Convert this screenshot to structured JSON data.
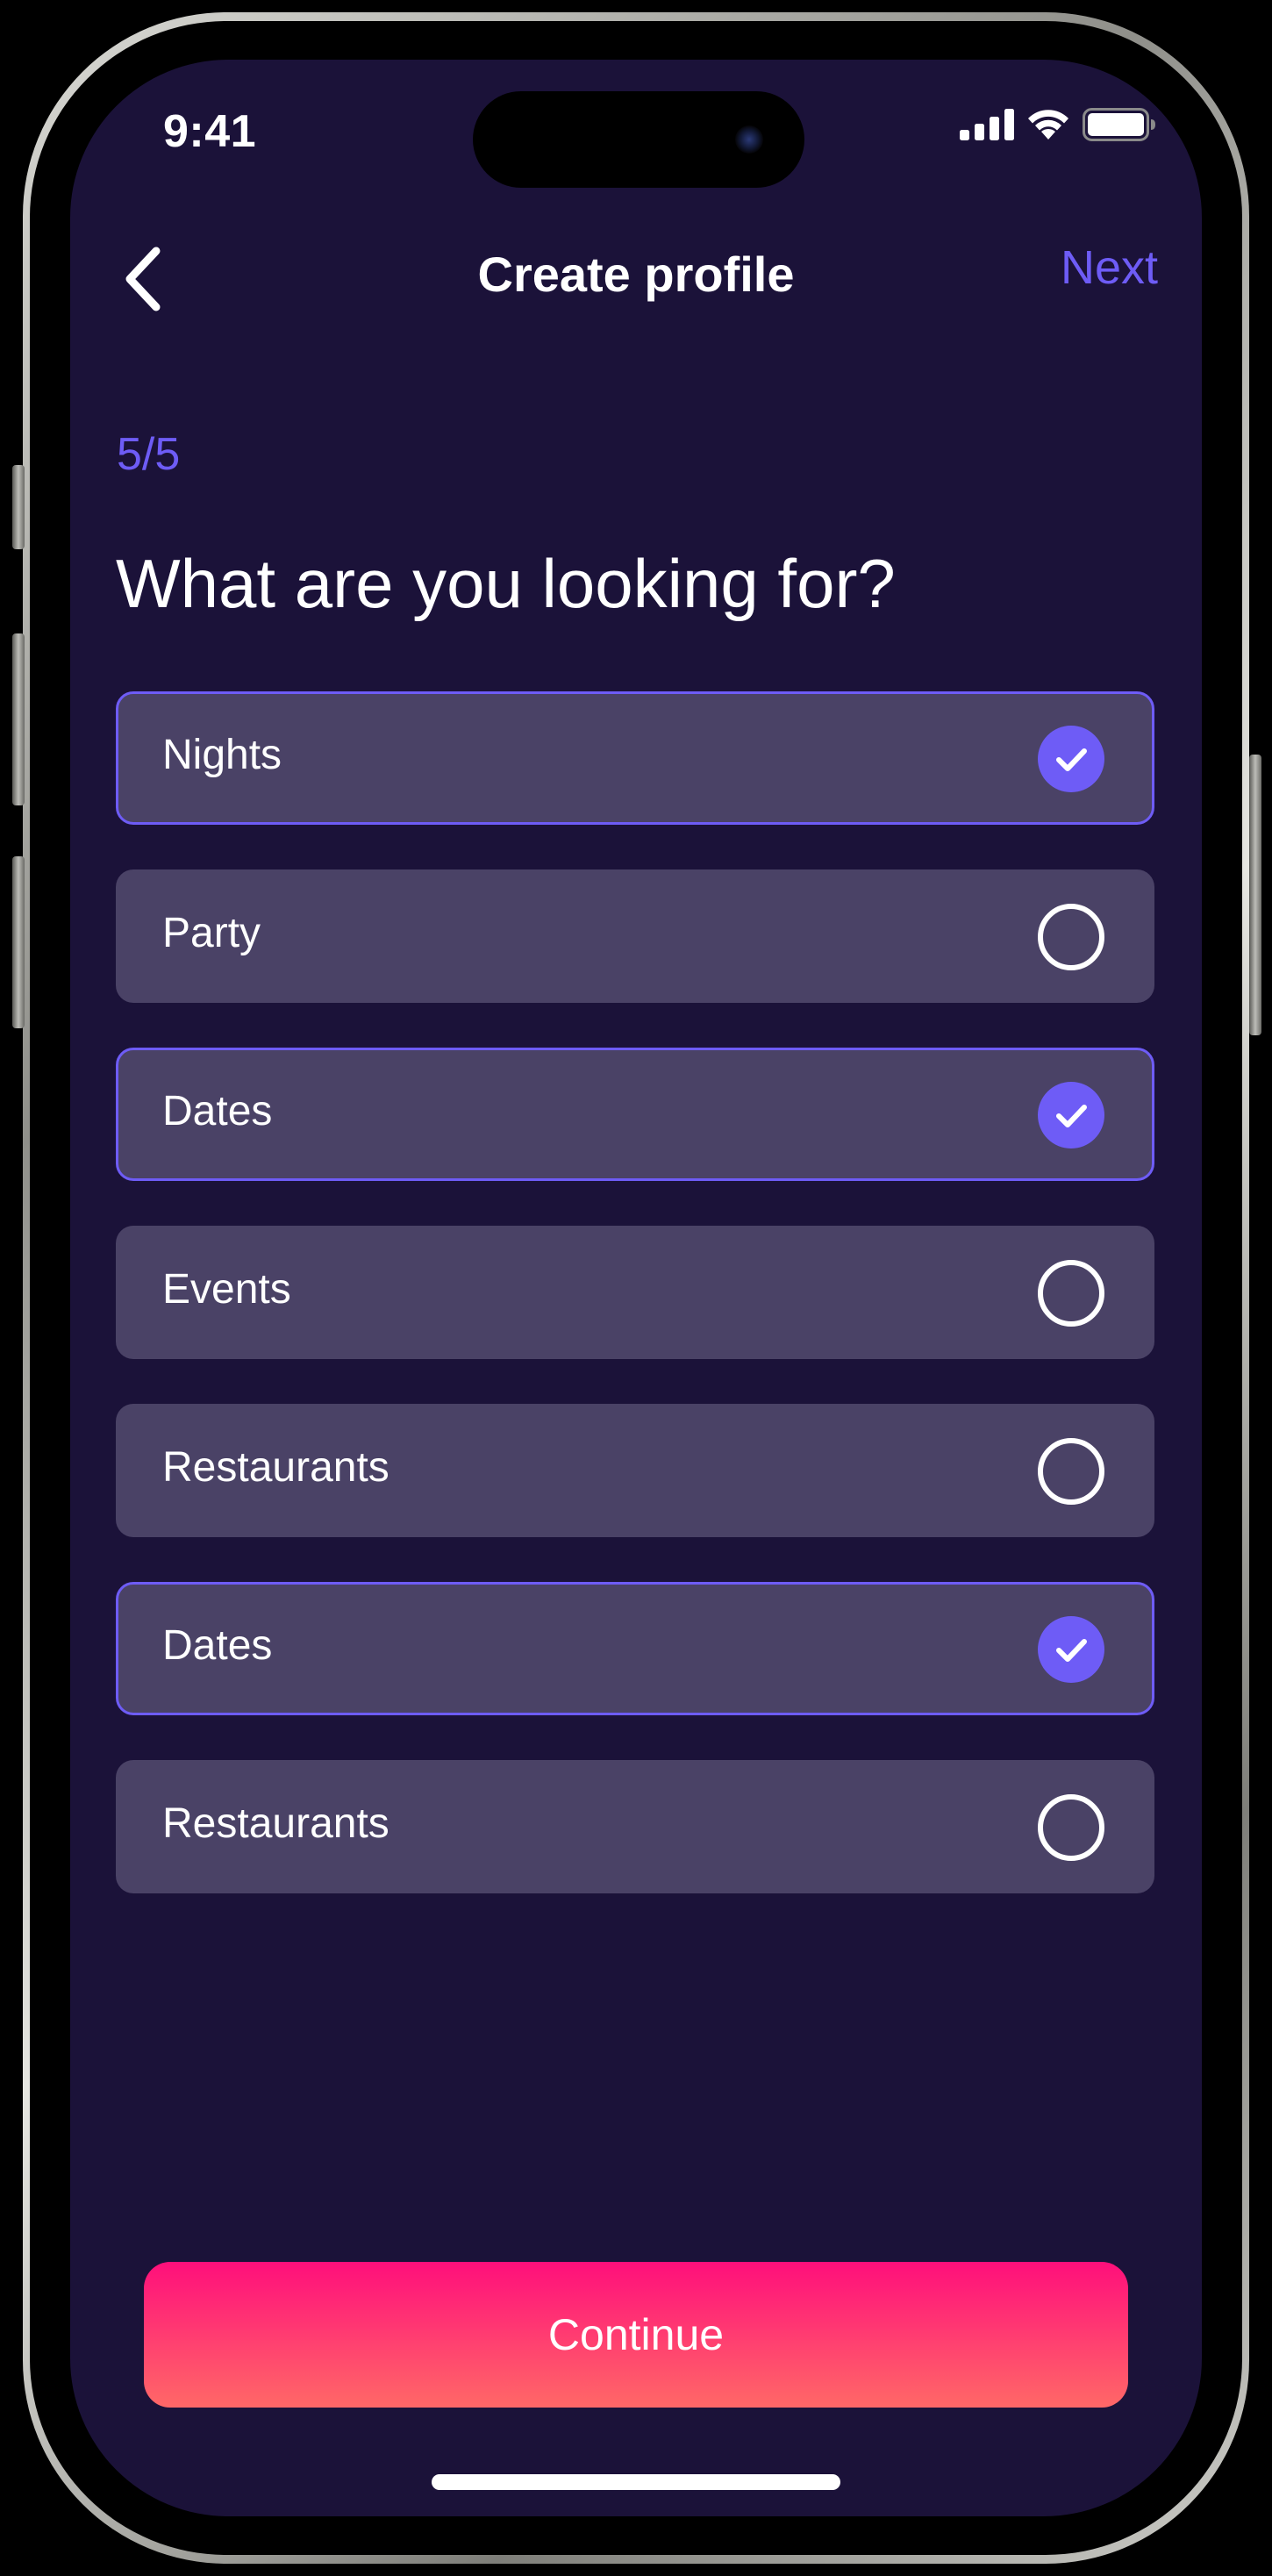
{
  "status_bar": {
    "time": "9:41",
    "signal_icon": "cellular-signal-icon",
    "wifi_icon": "wifi-icon",
    "battery_icon": "battery-icon"
  },
  "nav": {
    "back_icon": "chevron-left-icon",
    "title": "Create profile",
    "next_label": "Next"
  },
  "step": "5/5",
  "question": "What are you looking for?",
  "options": [
    {
      "label": "Nights",
      "selected": true
    },
    {
      "label": "Party",
      "selected": false
    },
    {
      "label": "Dates",
      "selected": true
    },
    {
      "label": "Events",
      "selected": false
    },
    {
      "label": "Restaurants",
      "selected": false
    },
    {
      "label": "Dates",
      "selected": true
    },
    {
      "label": "Restaurants",
      "selected": false
    }
  ],
  "continue_label": "Continue",
  "colors": {
    "background": "#1b1239",
    "card": "#4a4266",
    "accent": "#6e5cf6",
    "button_top": "#ff0f7b",
    "button_bottom": "#ff6867"
  }
}
